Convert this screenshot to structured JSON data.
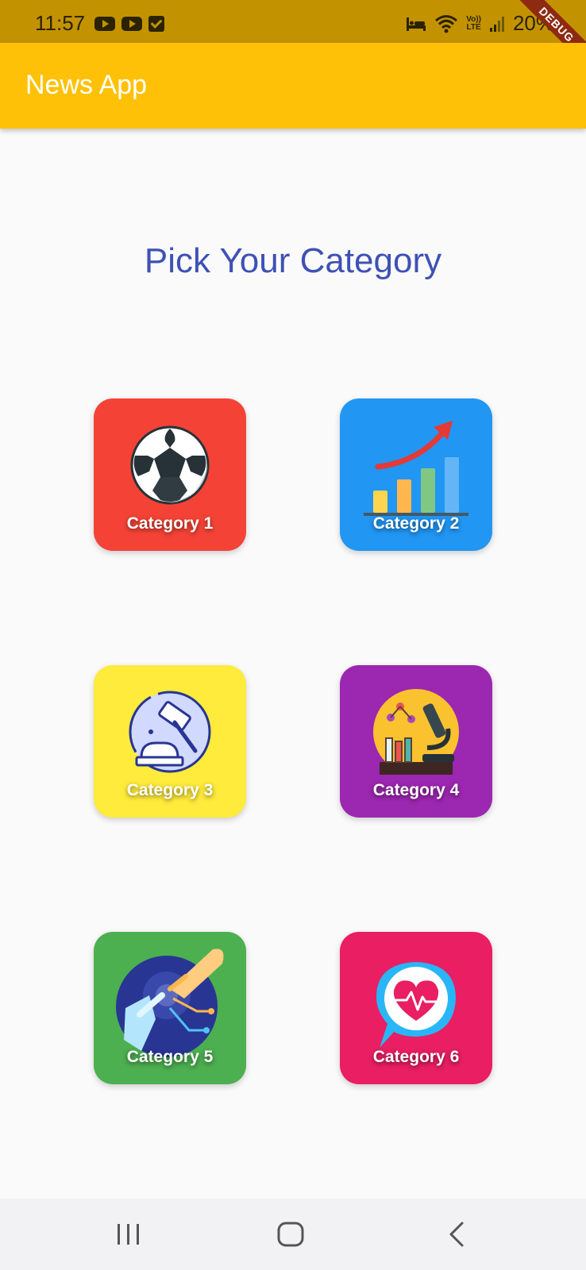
{
  "status_bar": {
    "time": "11:57",
    "battery": "20%",
    "lte_top": "Vo))",
    "lte_bottom": "LTE",
    "icons": [
      "youtube-icon",
      "youtube-icon",
      "checkbox-icon",
      "bed-icon",
      "wifi-icon",
      "lte-icon",
      "signal-icon"
    ]
  },
  "debug_banner": "DEBUG",
  "app_bar": {
    "title": "News App",
    "color": "#ffc107"
  },
  "heading": "Pick Your Category",
  "categories": [
    {
      "label": "Category 1",
      "icon": "soccer-ball-icon",
      "color": "#f44336"
    },
    {
      "label": "Category 2",
      "icon": "growth-chart-icon",
      "color": "#2196f3"
    },
    {
      "label": "Category 3",
      "icon": "gavel-icon",
      "color": "#ffeb3b"
    },
    {
      "label": "Category 4",
      "icon": "microscope-icon",
      "color": "#9c27b0"
    },
    {
      "label": "Category 5",
      "icon": "tech-touch-icon",
      "color": "#4caf50"
    },
    {
      "label": "Category 6",
      "icon": "health-chat-icon",
      "color": "#e91e63"
    }
  ],
  "nav_bar": {
    "buttons": [
      "recent-apps-icon",
      "home-icon",
      "back-icon"
    ]
  }
}
